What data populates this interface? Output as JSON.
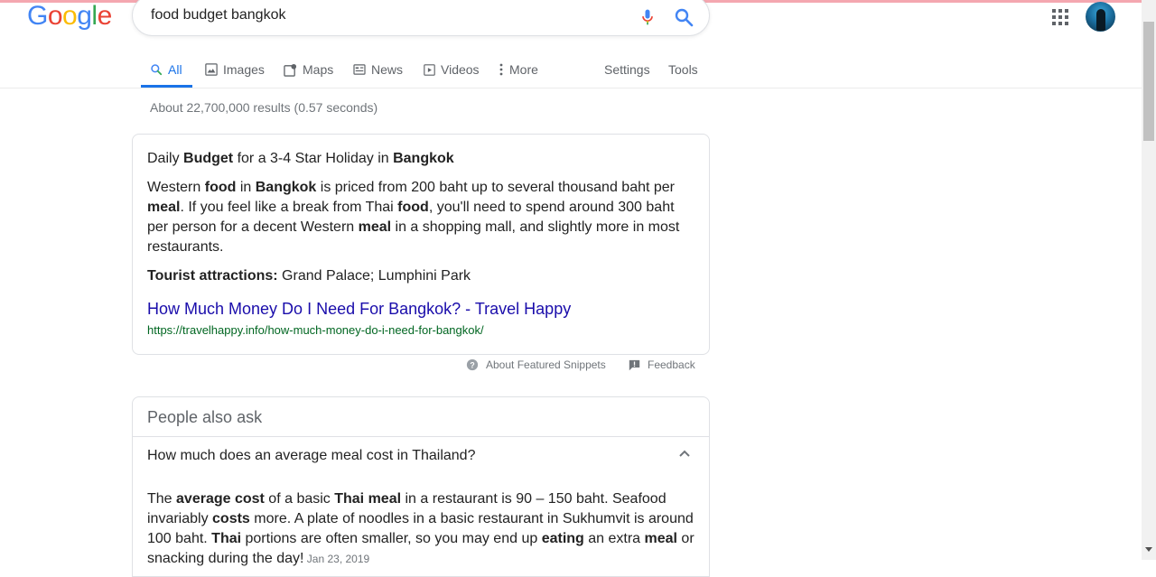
{
  "search": {
    "query": "food budget bangkok"
  },
  "logo": {
    "letters": [
      {
        "ch": "G",
        "color": "#4285F4"
      },
      {
        "ch": "o",
        "color": "#EA4335"
      },
      {
        "ch": "o",
        "color": "#FBBC05"
      },
      {
        "ch": "g",
        "color": "#4285F4"
      },
      {
        "ch": "l",
        "color": "#34A853"
      },
      {
        "ch": "e",
        "color": "#EA4335"
      }
    ]
  },
  "tabs": {
    "all": "All",
    "images": "Images",
    "maps": "Maps",
    "news": "News",
    "videos": "Videos",
    "more": "More",
    "settings": "Settings",
    "tools": "Tools"
  },
  "result_stats": "About 22,700,000 results (0.57 seconds)",
  "snippet": {
    "heading": [
      {
        "t": "Daily ",
        "b": false
      },
      {
        "t": "Budget",
        "b": true
      },
      {
        "t": " for a 3-4 Star Holiday in ",
        "b": false
      },
      {
        "t": "Bangkok",
        "b": true
      }
    ],
    "body": [
      {
        "t": "Western ",
        "b": false
      },
      {
        "t": "food",
        "b": true
      },
      {
        "t": " in ",
        "b": false
      },
      {
        "t": "Bangkok",
        "b": true
      },
      {
        "t": " is priced from 200 baht up to several thousand baht per ",
        "b": false
      },
      {
        "t": "meal",
        "b": true
      },
      {
        "t": ". If you feel like a break from Thai ",
        "b": false
      },
      {
        "t": "food",
        "b": true
      },
      {
        "t": ", you'll need to spend around 300 baht per person for a decent Western ",
        "b": false
      },
      {
        "t": "meal",
        "b": true
      },
      {
        "t": " in a shopping mall, and slightly more in most restaurants.",
        "b": false
      }
    ],
    "attractions_label": "Tourist attractions:",
    "attractions_value": " Grand Palace; Lumphini Park",
    "link_title": "How Much Money Do I Need For Bangkok? - Travel Happy",
    "link_url": "https://travelhappy.info/how-much-money-do-i-need-for-bangkok/",
    "about_label": "About Featured Snippets",
    "feedback_label": "Feedback"
  },
  "paa": {
    "title": "People also ask",
    "question": "How much does an average meal cost in Thailand?",
    "answer": [
      {
        "t": "The ",
        "b": false
      },
      {
        "t": "average cost",
        "b": true
      },
      {
        "t": " of a basic ",
        "b": false
      },
      {
        "t": "Thai meal",
        "b": true
      },
      {
        "t": " in a restaurant is 90 – 150 baht. Seafood invariably ",
        "b": false
      },
      {
        "t": "costs",
        "b": true
      },
      {
        "t": " more. A plate of noodles in a basic restaurant in Sukhumvit is around 100 baht. ",
        "b": false
      },
      {
        "t": "Thai",
        "b": true
      },
      {
        "t": " portions are often smaller, so you may end up ",
        "b": false
      },
      {
        "t": "eating",
        "b": true
      },
      {
        "t": " an extra ",
        "b": false
      },
      {
        "t": "meal",
        "b": true
      },
      {
        "t": " or snacking during the day!",
        "b": false
      }
    ],
    "answer_date": "Jan 23, 2019"
  },
  "colors": {
    "accent": "#1a73e8",
    "link": "#1a0dab",
    "url_green": "#006621",
    "muted": "#70757a"
  }
}
